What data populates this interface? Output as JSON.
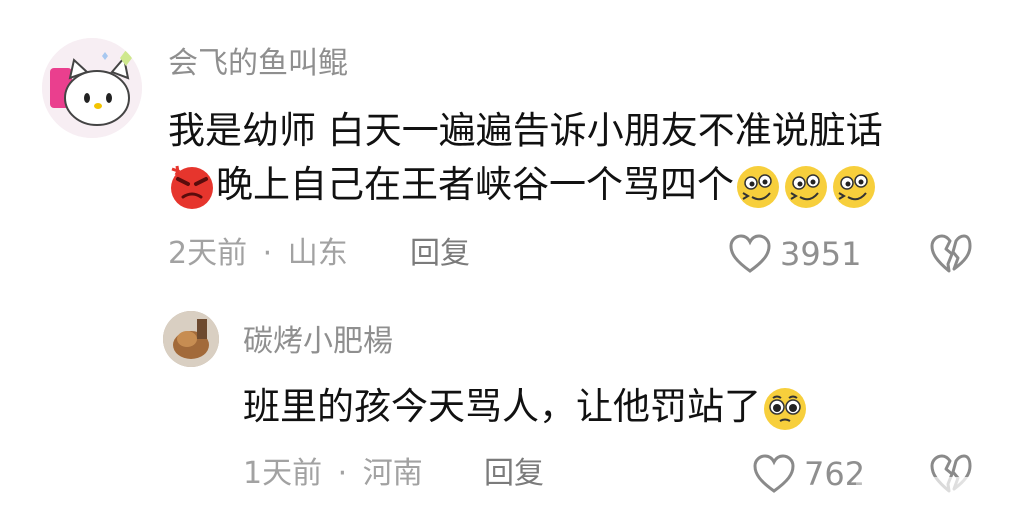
{
  "comments": [
    {
      "username": "会飞的鱼叫鲲",
      "text_line1": "我是幼师 白天一遍遍告诉小朋友不准说脏话",
      "text_line2": "晚上自己在王者峡谷一个骂四个",
      "emojis": [
        "angry-face-icon",
        "dizzy-smile-emoji-icon"
      ],
      "time": "2天前",
      "location": "山东",
      "reply_label": "回复",
      "likes": "3951"
    },
    {
      "username": "碳烤小肥楊",
      "text": "班里的孩今天骂人，让他罚站了",
      "emojis": [
        "pleading-face-icon"
      ],
      "time": "1天前",
      "location": "河南",
      "reply_label": "回复",
      "likes": "762"
    }
  ],
  "separator": "·",
  "colors": {
    "meta": "#a2a2a2",
    "username": "#8f8f8f",
    "text": "#111111",
    "angry": "#e6352d"
  }
}
